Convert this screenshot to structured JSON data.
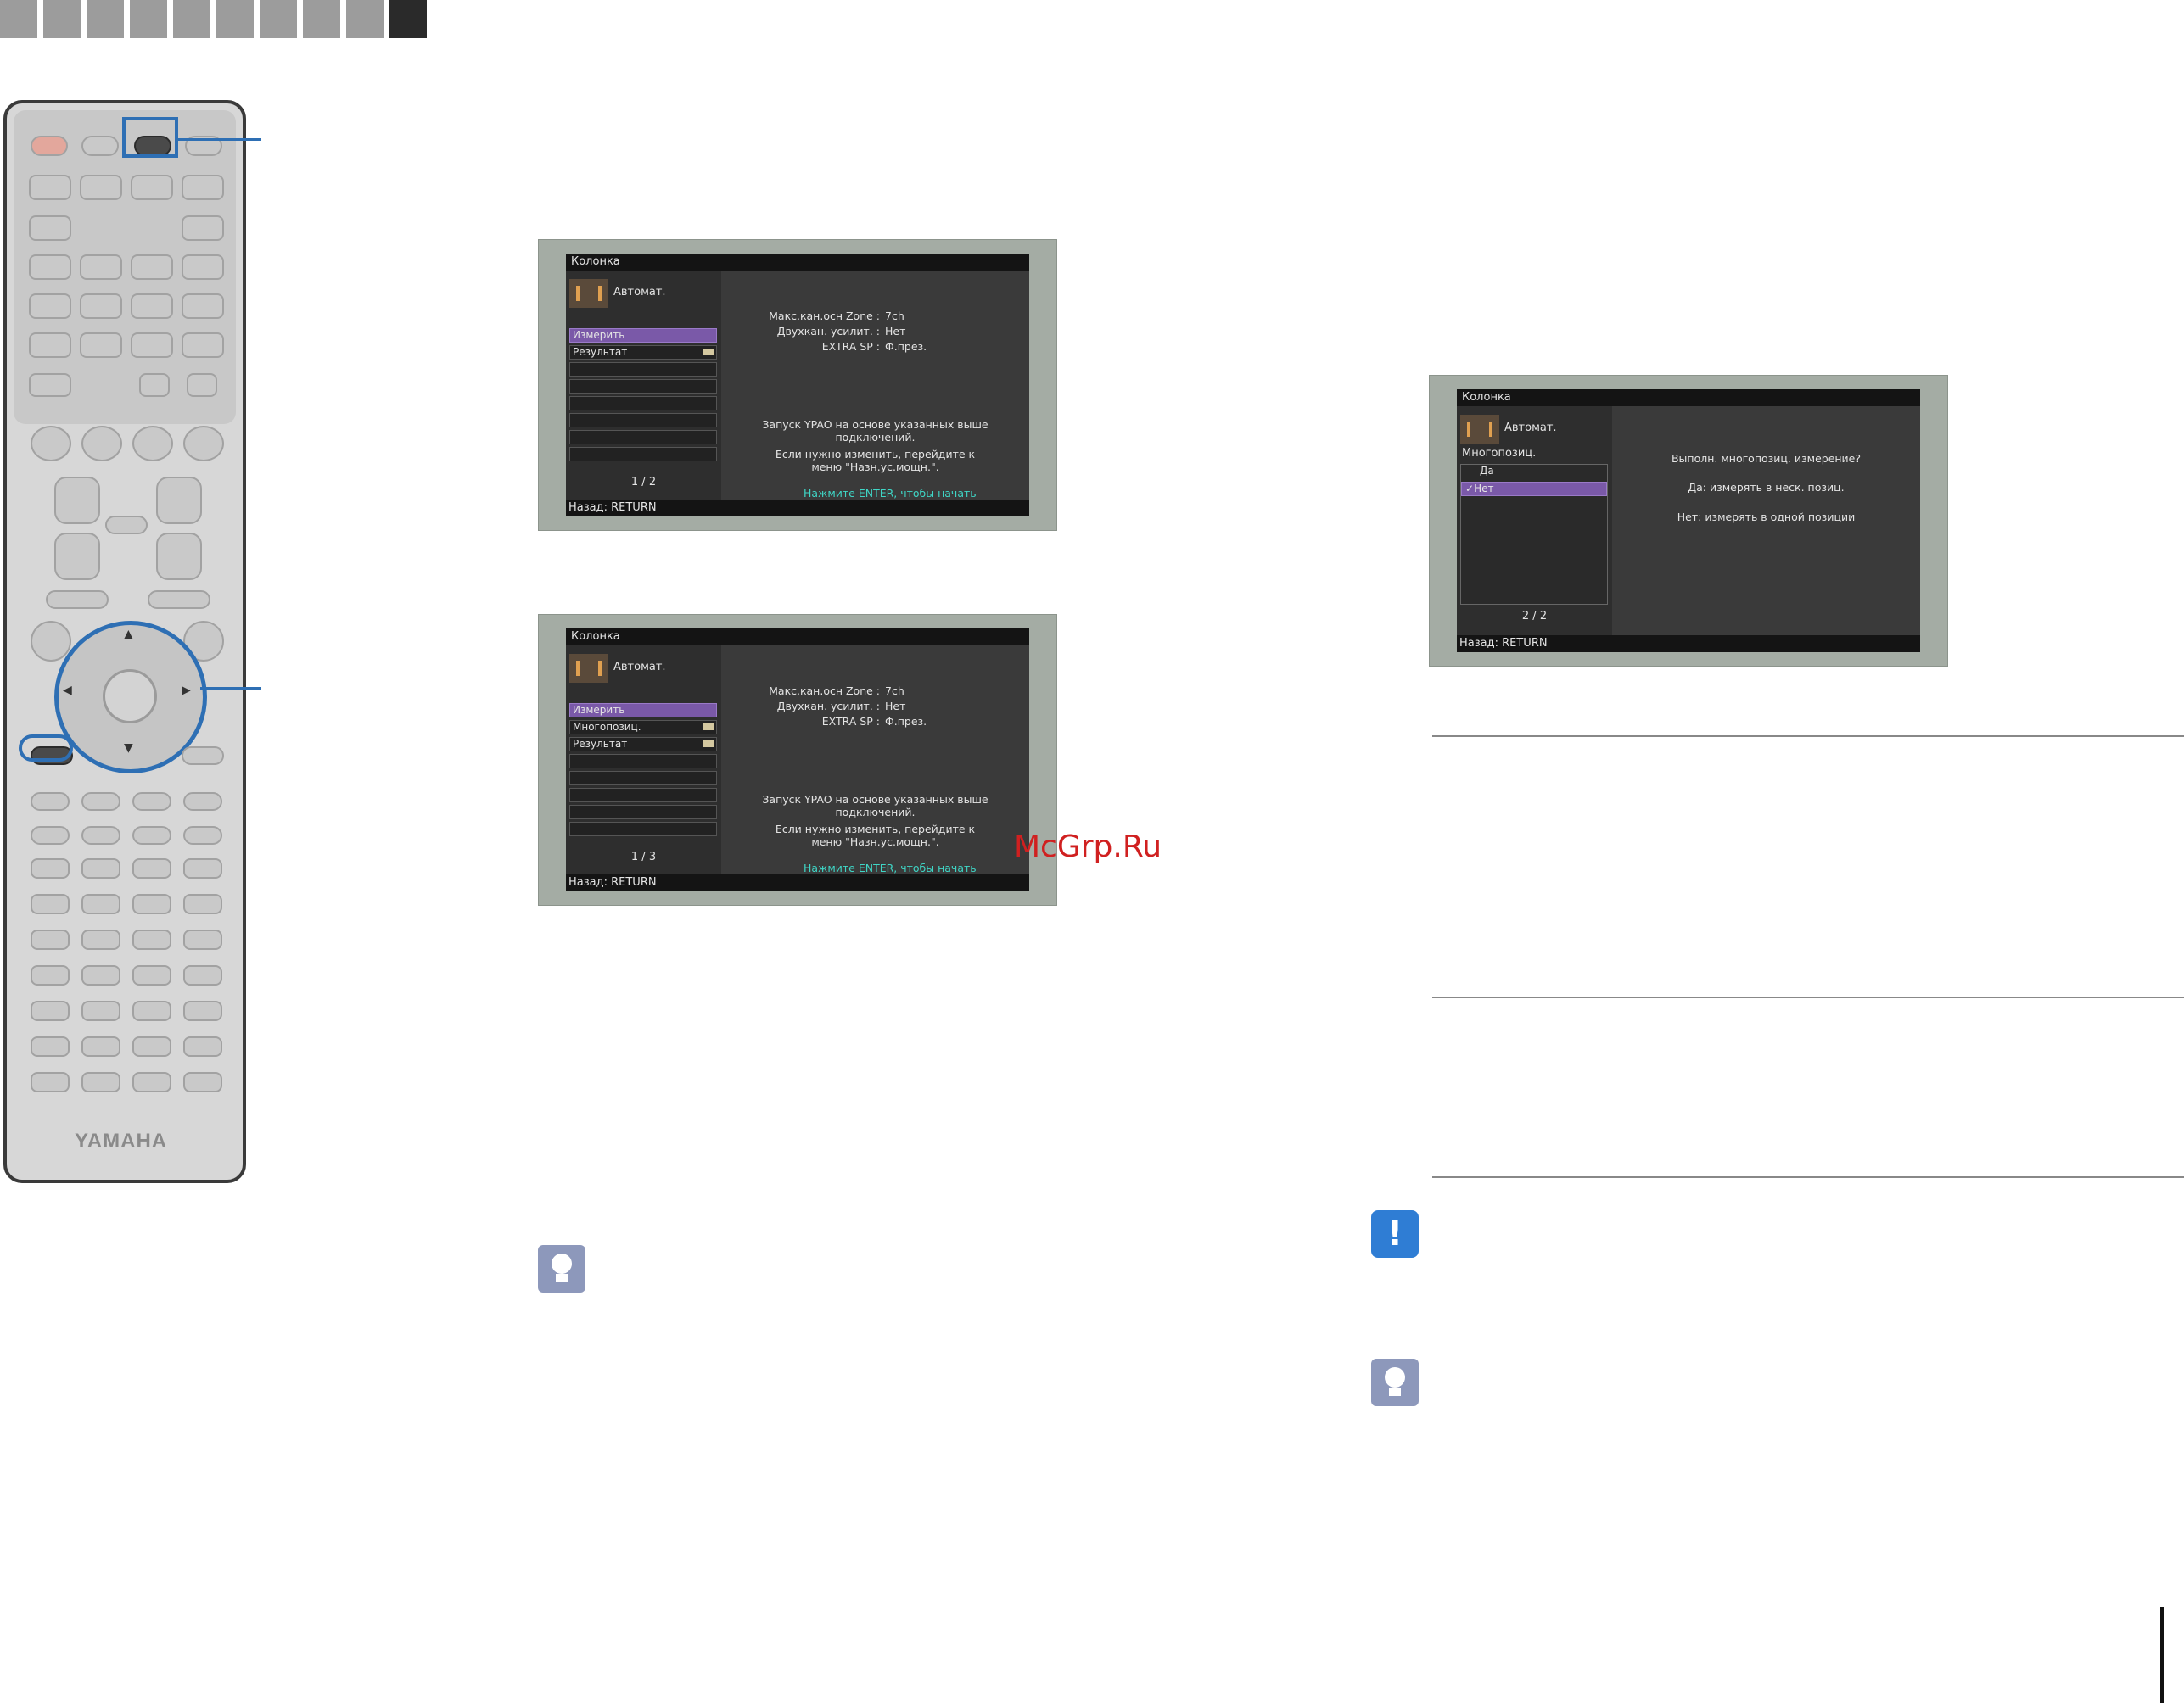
{
  "header_tabs": {
    "count": 10,
    "active_index": 9
  },
  "remote": {
    "brand": "YAMAHA"
  },
  "screen1": {
    "title": "Колонка",
    "mode": "Автомат.",
    "menu": [
      "Измерить",
      "Результат"
    ],
    "page": "1 / 2",
    "info_labels": [
      "Макс.кан.осн Zone :",
      "Двухкан. усилит. :",
      "EXTRA SP :"
    ],
    "info_values": [
      "7ch",
      "Нет",
      "Ф.през."
    ],
    "message_line1": "Запуск YPAO на основе указанных выше",
    "message_line2": "подключений.",
    "message_line3": "Если нужно изменить, перейдите к",
    "message_line4": "меню \"Назн.ус.мощн.\".",
    "hint": "Нажмите ENTER, чтобы начать",
    "footer": "Назад: RETURN"
  },
  "screen2": {
    "title": "Колонка",
    "mode": "Автомат.",
    "menu": [
      "Измерить",
      "Многопозиц.",
      "Результат"
    ],
    "page": "1 / 3",
    "info_labels": [
      "Макс.кан.осн Zone :",
      "Двухкан. усилит. :",
      "EXTRA SP :"
    ],
    "info_values": [
      "7ch",
      "Нет",
      "Ф.през."
    ],
    "message_line1": "Запуск YPAO на основе указанных выше",
    "message_line2": "подключений.",
    "message_line3": "Если нужно изменить, перейдите к",
    "message_line4": "меню \"Назн.ус.мощн.\".",
    "hint": "Нажмите ENTER, чтобы начать",
    "footer": "Назад: RETURN"
  },
  "screen3": {
    "title": "Колонка",
    "mode": "Автомат.",
    "section": "Многопозиц.",
    "options": [
      "Да",
      "Нет"
    ],
    "selected_option": "Нет",
    "page": "2 / 2",
    "question": "Выполн. многопозиц. измерение?",
    "line_yes": "Да:  измерять в неск. позиц.",
    "line_no": "Нет:  измерять в одной позиции",
    "footer": "Назад: RETURN"
  },
  "watermark": "McGrp.Ru",
  "icons": {
    "tip": "lightbulb-icon",
    "note": "exclamation-icon"
  },
  "colors": {
    "accent": "#2e6fb4",
    "selection": "#7a59a8",
    "hint": "#3fd6c6",
    "watermark": "#d02020"
  }
}
